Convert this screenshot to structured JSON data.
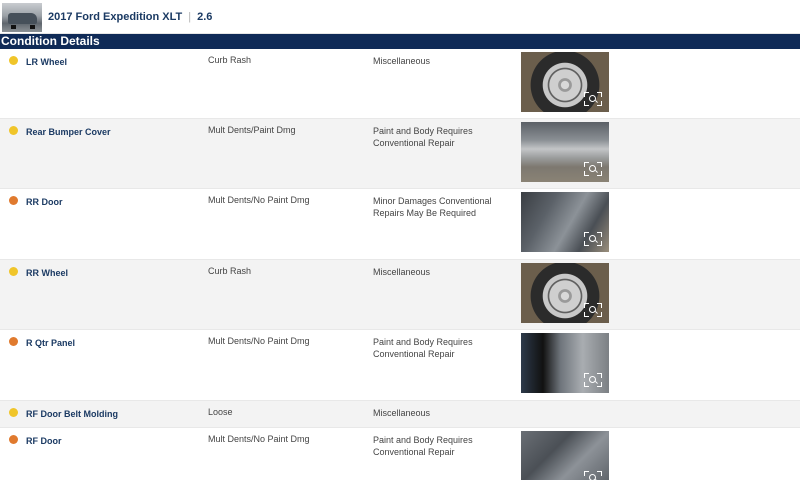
{
  "header": {
    "vehicle_title": "2017 Ford Expedition XLT",
    "separator": "|",
    "grade": "2.6"
  },
  "section": {
    "title": "Condition Details"
  },
  "colors": {
    "navy": "#0f2a57",
    "title_blue": "#1b3a63",
    "severity_yellow": "#f0c52a",
    "severity_orange": "#e07a2e"
  },
  "rows": [
    {
      "severity": "yellow",
      "part": "LR Wheel",
      "damage": "Curb Rash",
      "action_line1": "Miscellaneous",
      "action_line2": "",
      "photo": "wheel"
    },
    {
      "severity": "yellow",
      "part": "Rear Bumper Cover",
      "damage": "Mult Dents/Paint Dmg",
      "action_line1": "Paint and Body Requires",
      "action_line2": "Conventional Repair",
      "photo": "bumper"
    },
    {
      "severity": "orange",
      "part": "RR Door",
      "damage": "Mult Dents/No Paint Dmg",
      "action_line1": "Minor Damages Conventional",
      "action_line2": "Repairs May Be Required",
      "photo": "door"
    },
    {
      "severity": "yellow",
      "part": "RR Wheel",
      "damage": "Curb Rash",
      "action_line1": "Miscellaneous",
      "action_line2": "",
      "photo": "wheel"
    },
    {
      "severity": "orange",
      "part": "R Qtr Panel",
      "damage": "Mult Dents/No Paint Dmg",
      "action_line1": "Paint and Body Requires",
      "action_line2": "Conventional Repair",
      "photo": "qtr"
    },
    {
      "severity": "yellow",
      "part": "RF Door Belt Molding",
      "damage": "Loose",
      "action_line1": "Miscellaneous",
      "action_line2": "",
      "photo": ""
    },
    {
      "severity": "orange",
      "part": "RF Door",
      "damage": "Mult Dents/No Paint Dmg",
      "action_line1": "Paint and Body Requires",
      "action_line2": "Conventional Repair",
      "photo": "rfdoor"
    }
  ]
}
